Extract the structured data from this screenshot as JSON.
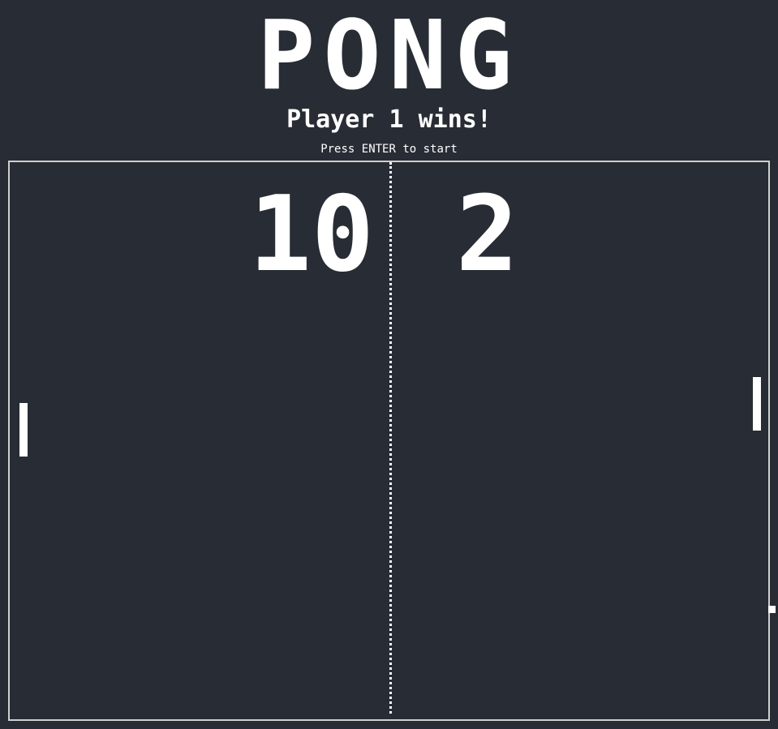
{
  "game": {
    "title": "PONG",
    "message": "Player 1 wins!",
    "hint": "Press ENTER to start"
  },
  "scores": {
    "player1": "10",
    "player2": "2"
  },
  "colors": {
    "background": "#282c34",
    "foreground": "#ffffff",
    "border": "#d0d0d0"
  }
}
